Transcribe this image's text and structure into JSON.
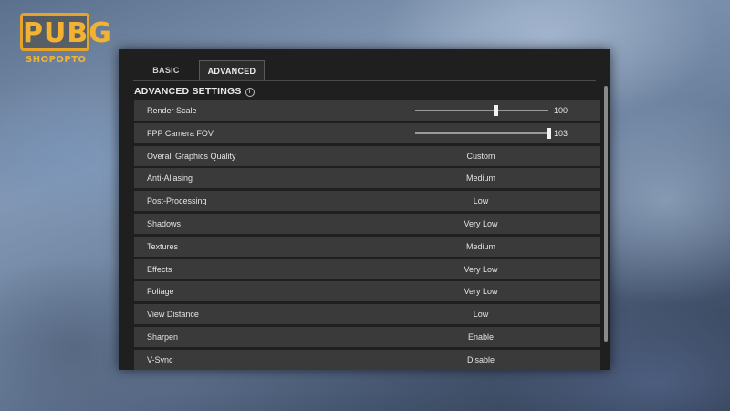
{
  "logo": {
    "main": "PUBG",
    "sub": "SHOPOPTO"
  },
  "tabs": [
    {
      "label": "BASIC"
    },
    {
      "label": "ADVANCED"
    }
  ],
  "section_title": "ADVANCED SETTINGS",
  "settings": [
    {
      "label": "Render Scale",
      "type": "slider",
      "value": "100",
      "level": 0.6
    },
    {
      "label": "FPP Camera FOV",
      "type": "slider",
      "value": "103",
      "level": 1.0
    },
    {
      "label": "Overall Graphics Quality",
      "type": "select",
      "value": "Custom"
    },
    {
      "label": "Anti-Aliasing",
      "type": "select",
      "value": "Medium"
    },
    {
      "label": "Post-Processing",
      "type": "select",
      "value": "Low"
    },
    {
      "label": "Shadows",
      "type": "select",
      "value": "Very Low"
    },
    {
      "label": "Textures",
      "type": "select",
      "value": "Medium"
    },
    {
      "label": "Effects",
      "type": "select",
      "value": "Very Low"
    },
    {
      "label": "Foliage",
      "type": "select",
      "value": "Very Low"
    },
    {
      "label": "View Distance",
      "type": "select",
      "value": "Low"
    },
    {
      "label": "Sharpen",
      "type": "select",
      "value": "Enable"
    },
    {
      "label": "V-Sync",
      "type": "select",
      "value": "Disable"
    }
  ]
}
